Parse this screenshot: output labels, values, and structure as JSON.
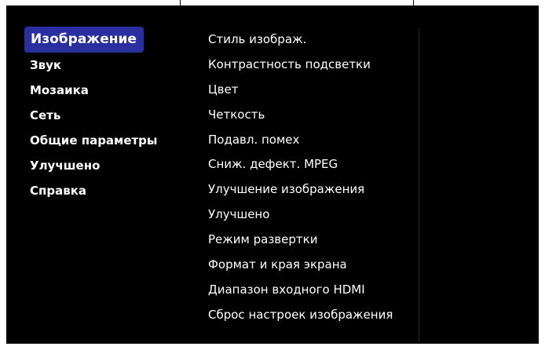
{
  "left_menu": {
    "items": [
      {
        "label": "Изображение",
        "selected": true
      },
      {
        "label": "Звук"
      },
      {
        "label": "Мозаика"
      },
      {
        "label": "Сеть"
      },
      {
        "label": "Общие параметры"
      },
      {
        "label": "Улучшено"
      },
      {
        "label": "Справка"
      }
    ]
  },
  "right_menu": {
    "items": [
      {
        "label": "Стиль изображ."
      },
      {
        "label": "Контрастность подсветки"
      },
      {
        "label": "Цвет"
      },
      {
        "label": "Четкость"
      },
      {
        "label": "Подавл. помех"
      },
      {
        "label": "Сниж. дефект. MPEG"
      },
      {
        "label": "Улучшение изображения"
      },
      {
        "label": "Улучшено"
      },
      {
        "label": "Режим развертки"
      },
      {
        "label": "Формат и края экрана"
      },
      {
        "label": "Диапазон входного HDMI"
      },
      {
        "label": "Сброс настроек изображения"
      }
    ]
  },
  "colors": {
    "background": "#000000",
    "selection": "#2a2fa0",
    "text": "#ffffff"
  }
}
